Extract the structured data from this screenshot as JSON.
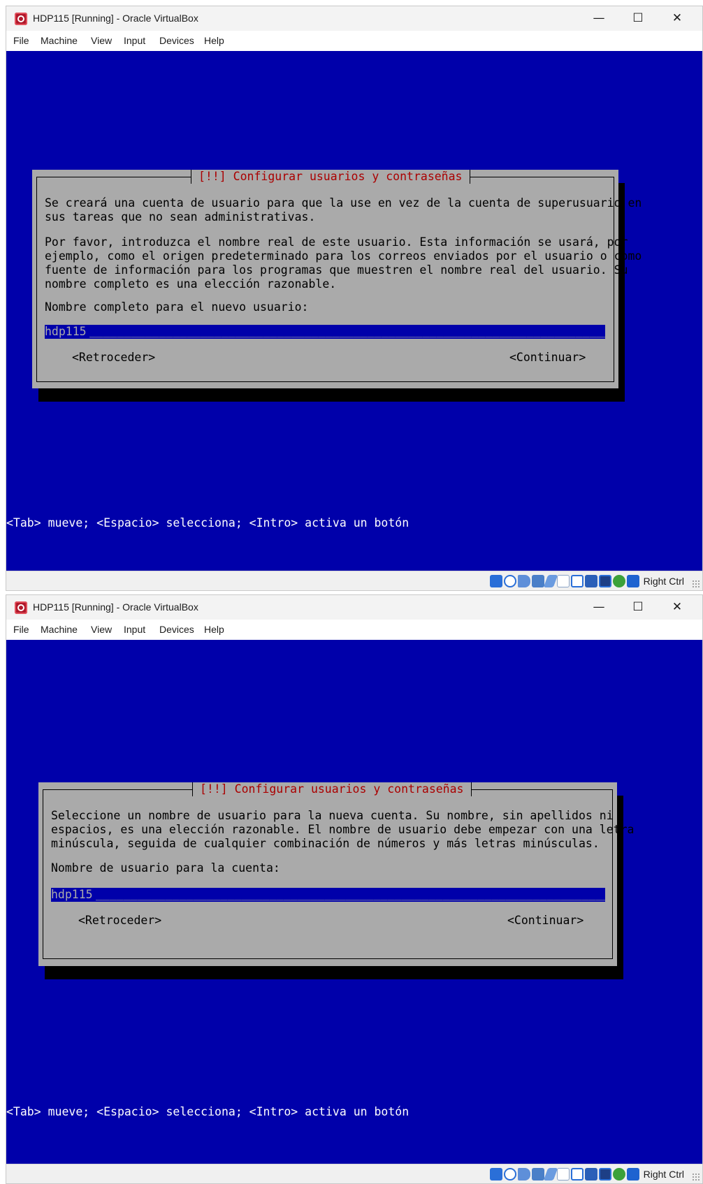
{
  "windows": [
    {
      "title": "HDP115 [Running] - Oracle VirtualBox",
      "controls": {
        "minimize": "—",
        "maximize": "☐",
        "close": "✕"
      },
      "menu": [
        "File",
        "Machine",
        "View",
        "Input",
        "Devices",
        "Help"
      ],
      "dialog": {
        "title": "[!!] Configurar usuarios y contraseñas",
        "paragraphs": [
          "Se creará una cuenta de usuario para que la use en vez de la cuenta de superusuario en\nsus tareas que no sean administrativas.",
          "Por favor, introduzca el nombre real de este usuario. Esta información se usará, por\nejemplo, como el origen predeterminado para los correos enviados por el usuario o como\nfuente de información para los programas que muestren el nombre real del usuario. Su\nnombre completo es una elección razonable."
        ],
        "prompt": "Nombre completo para el nuevo usuario:",
        "input_value": "hdp115",
        "back_button": "<Retroceder>",
        "continue_button": "<Continuar>"
      },
      "help_line": "<Tab> mueve; <Espacio> selecciona; <Intro> activa un botón",
      "status": {
        "host_key": "Right Ctrl"
      }
    },
    {
      "title": "HDP115 [Running] - Oracle VirtualBox",
      "controls": {
        "minimize": "—",
        "maximize": "☐",
        "close": "✕"
      },
      "menu": [
        "File",
        "Machine",
        "View",
        "Input",
        "Devices",
        "Help"
      ],
      "dialog": {
        "title": "[!!] Configurar usuarios y contraseñas",
        "paragraphs": [
          "Seleccione un nombre de usuario para la nueva cuenta. Su nombre, sin apellidos ni\nespacios, es una elección razonable. El nombre de usuario debe empezar con una letra\nminúscula, seguida de cualquier combinación de números y más letras minúsculas."
        ],
        "prompt": "Nombre de usuario para la cuenta:",
        "input_value": "hdp115",
        "back_button": "<Retroceder>",
        "continue_button": "<Continuar>"
      },
      "help_line": "<Tab> mueve; <Espacio> selecciona; <Intro> activa un botón",
      "status": {
        "host_key": "Right Ctrl"
      }
    }
  ],
  "icons": [
    "hard-disk-icon",
    "optical-drive-icon",
    "audio-icon",
    "network-icon",
    "usb-icon",
    "shared-folders-icon",
    "display-icon",
    "recording-icon",
    "cpu-icon",
    "mouse-integration-icon",
    "keyboard-capture-icon"
  ],
  "colors": {
    "vm_background": "#0000aa",
    "dialog_background": "#aaaaaa",
    "dialog_title": "#aa0000",
    "input_background": "#0000aa"
  }
}
